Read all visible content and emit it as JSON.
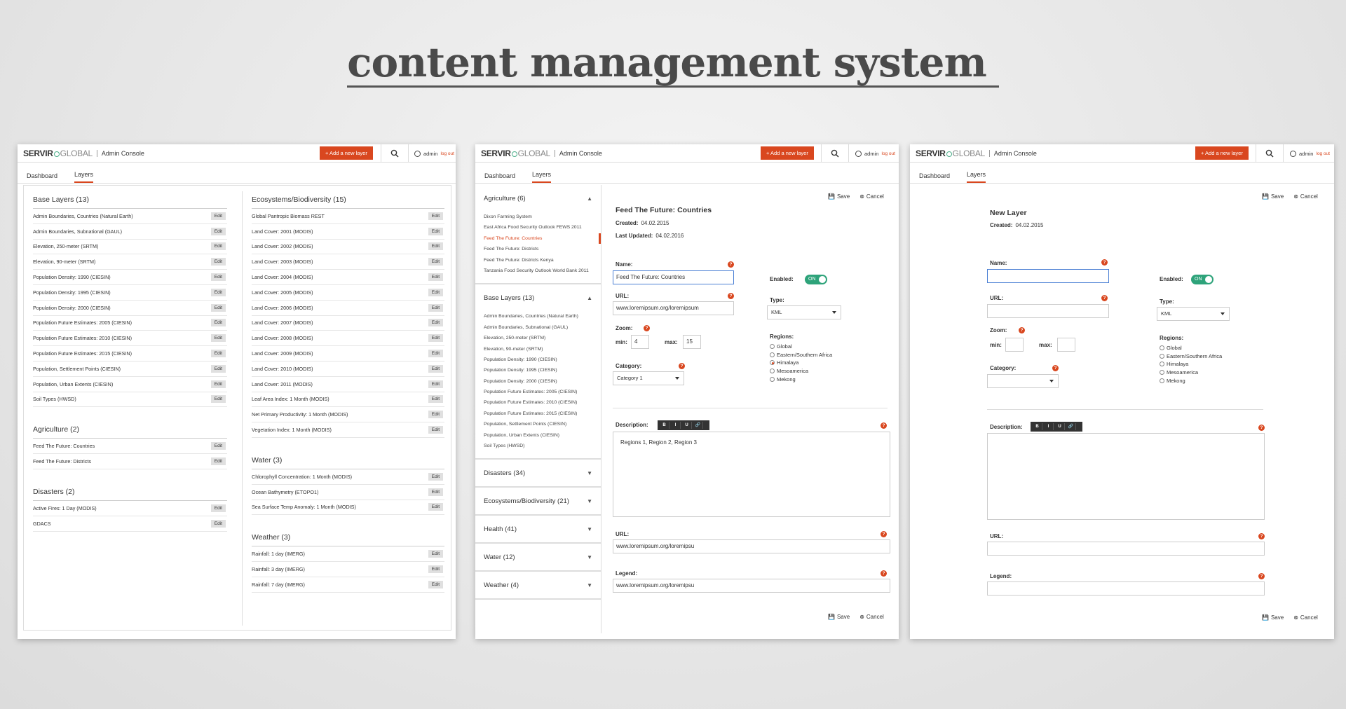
{
  "hero_title": "content management system",
  "app": {
    "logo_a": "SERVIR",
    "logo_b": "GLOBAL",
    "console": "Admin Console",
    "add_layer": "+ Add a new layer",
    "user": "admin",
    "logout": "log out",
    "tabs": [
      "Dashboard",
      "Layers"
    ]
  },
  "screen1": {
    "col1": [
      {
        "title": "Base Layers (13)",
        "items": [
          "Admin Boundaries, Countries (Natural Earth)",
          "Admin Boundaries, Subnational (GAUL)",
          "Elevation, 250-meter (SRTM)",
          "Elevation, 90-meter (SRTM)",
          "Population Density: 1990 (CIESIN)",
          "Population Density: 1995 (CIESIN)",
          "Population Density: 2000 (CIESIN)",
          "Population Future Estimates: 2005 (CIESIN)",
          "Population Future Estimates: 2010 (CIESIN)",
          "Population Future Estimates: 2015 (CIESIN)",
          "Population, Settlement Points (CIESIN)",
          "Population, Urban Extents (CIESIN)",
          "Soil Types (HWSD)"
        ]
      },
      {
        "title": "Agriculture (2)",
        "items": [
          "Feed The Future: Countries",
          "Feed The Future: Districts"
        ]
      },
      {
        "title": "Disasters (2)",
        "items": [
          "Active Fires: 1 Day (MODIS)",
          "GDACS"
        ]
      }
    ],
    "col2": [
      {
        "title": "Ecosystems/Biodiversity (15)",
        "items": [
          "Global Pantropic Biomass REST",
          "Land Cover: 2001 (MODIS)",
          "Land Cover: 2002 (MODIS)",
          "Land Cover: 2003 (MODIS)",
          "Land Cover: 2004 (MODIS)",
          "Land Cover: 2005 (MODIS)",
          "Land Cover: 2006 (MODIS)",
          "Land Cover: 2007 (MODIS)",
          "Land Cover: 2008 (MODIS)",
          "Land Cover: 2009 (MODIS)",
          "Land Cover: 2010 (MODIS)",
          "Land Cover: 2011 (MODIS)",
          "Leaf Area Index: 1 Month (MODIS)",
          "Net Primary Productivity: 1 Month (MODIS)",
          "Vegetation Index: 1 Month (MODIS)"
        ]
      },
      {
        "title": "Water (3)",
        "items": [
          "Chlorophyll Concentration: 1 Month (MODIS)",
          "Ocean Bathymetry (ETOPO1)",
          "Sea Surface Temp Anomaly: 1 Month (MODIS)"
        ]
      },
      {
        "title": "Weather (3)",
        "items": [
          "Rainfall: 1 day (IMERG)",
          "Rainfall: 3 day (IMERG)",
          "Rainfall: 7 day (IMERG)"
        ]
      }
    ],
    "edit_label": "Edit"
  },
  "screen2": {
    "sidebar": [
      {
        "title": "Agriculture (6)",
        "expanded": true,
        "items": [
          "Dixon Farming System",
          "East Africa Food Security Outlook FEWS 2011",
          "Feed The Future: Countries",
          "Feed The Future: Districts",
          "Feed The Future: Districts Kenya",
          "Tanzania Food Security Outlook World Bank 2011"
        ],
        "active": 2
      },
      {
        "title": "Base Layers (13)",
        "expanded": true,
        "items": [
          "Admin Boundaries, Countries (Natural Earth)",
          "Admin Boundaries, Subnational (GAUL)",
          "Elevation, 250-meter (SRTM)",
          "Elevation, 90-meter (SRTM)",
          "Population Density: 1990 (CIESIN)",
          "Population Density: 1995 (CIESIN)",
          "Population Density: 2000 (CIESIN)",
          "Population Future Estimates: 2005 (CIESIN)",
          "Population Future Estimates: 2010 (CIESIN)",
          "Population Future Estimates: 2015 (CIESIN)",
          "Population, Settlement Points (CIESIN)",
          "Population, Urban Extents (CIESIN)",
          "Soil Types (HWSD)"
        ],
        "active": -1
      },
      {
        "title": "Disasters (34)",
        "expanded": false,
        "items": [],
        "active": -1
      },
      {
        "title": "Ecosystems/Biodiversity (21)",
        "expanded": false,
        "items": [],
        "active": -1
      },
      {
        "title": "Health (41)",
        "expanded": false,
        "items": [],
        "active": -1
      },
      {
        "title": "Water (12)",
        "expanded": false,
        "items": [],
        "active": -1
      },
      {
        "title": "Weather (4)",
        "expanded": false,
        "items": [],
        "active": -1
      }
    ],
    "form": {
      "title": "Feed The Future: Countries",
      "created_label": "Created:",
      "created": "04.02.2015",
      "updated_label": "Last Updated:",
      "updated": "04.02.2016",
      "name_label": "Name:",
      "name_value": "Feed The Future: Countries",
      "url_label": "URL:",
      "url_value": "www.loremipsum.org/loremipsum",
      "zoom_label": "Zoom:",
      "min_label": "min:",
      "min_value": "4",
      "max_label": "max:",
      "max_value": "15",
      "category_label": "Category:",
      "category_value": "Category 1",
      "enabled_label": "Enabled:",
      "toggle": "ON",
      "type_label": "Type:",
      "type_value": "KML",
      "regions_label": "Regions:",
      "regions": [
        "Global",
        "Eastern/Southern Africa",
        "Himalaya",
        "Mesoamerica",
        "Mekong"
      ],
      "selected_region": "Himalaya",
      "description_label": "Description:",
      "description": "Regions 1, Region 2, Region 3",
      "url2_label": "URL:",
      "url2_value": "www.loremipsum.org/loremipsu",
      "legend_label": "Legend:",
      "legend_value": "www.loremipsum.org/loremipsu",
      "save": "Save",
      "cancel": "Cancel",
      "toolbar": [
        "B",
        "I",
        "U",
        "🔗"
      ]
    }
  },
  "screen3": {
    "form": {
      "title": "New Layer",
      "created_label": "Created:",
      "created": "04.02.2015",
      "name_label": "Name:",
      "url_label": "URL:",
      "zoom_label": "Zoom:",
      "min_label": "min:",
      "max_label": "max:",
      "category_label": "Category:",
      "enabled_label": "Enabled:",
      "toggle": "ON",
      "type_label": "Type:",
      "type_value": "KML",
      "regions_label": "Regions:",
      "regions": [
        "Global",
        "Eastern/Southern Africa",
        "Himalaya",
        "Mesoamerica",
        "Mekong"
      ],
      "description_label": "Description:",
      "url2_label": "URL:",
      "legend_label": "Legend:",
      "save": "Save",
      "cancel": "Cancel",
      "toolbar": [
        "B",
        "I",
        "U",
        "🔗"
      ]
    }
  },
  "colors": {
    "accent": "#d9471f",
    "toggle": "#2ea37a",
    "focus": "#4a7fd4"
  }
}
